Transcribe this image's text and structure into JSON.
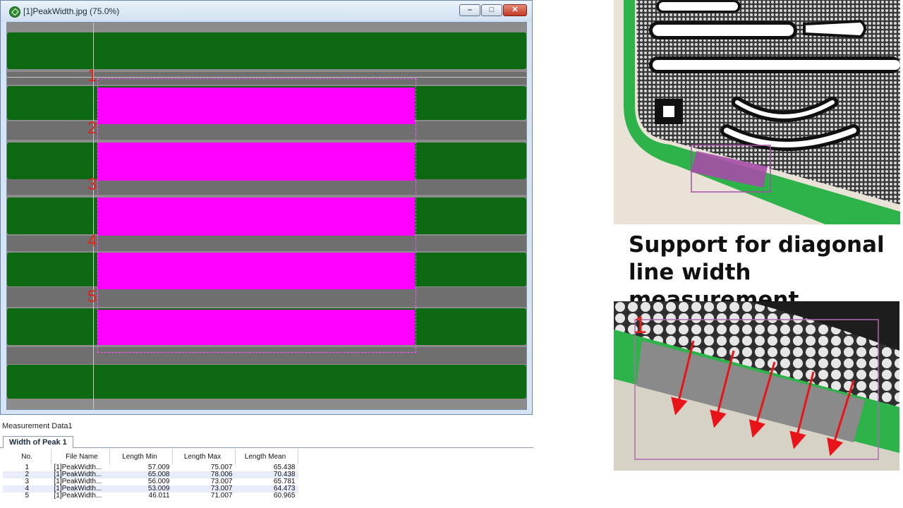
{
  "window": {
    "title": "[1]PeakWidth.jpg (75.0%)",
    "minimize_glyph": "–",
    "maximize_glyph": "□",
    "close_glyph": "✕"
  },
  "measurement": {
    "panel_title": "Measurement Data1",
    "tab_label": "Width of Peak 1",
    "columns": [
      "No.",
      "File Name",
      "Length Min",
      "Length Max",
      "Length Mean"
    ],
    "rows": [
      {
        "no": "1",
        "file": "[1]PeakWidth...",
        "min": "57.009",
        "max": "75.007",
        "mean": "65.438"
      },
      {
        "no": "2",
        "file": "[1]PeakWidth...",
        "min": "65.008",
        "max": "78.006",
        "mean": "70.438"
      },
      {
        "no": "3",
        "file": "[1]PeakWidth...",
        "min": "56.009",
        "max": "73.007",
        "mean": "65.781"
      },
      {
        "no": "4",
        "file": "[1]PeakWidth...",
        "min": "53.009",
        "max": "73.007",
        "mean": "64.473"
      },
      {
        "no": "5",
        "file": "[1]PeakWidth...",
        "min": "46.011",
        "max": "71.007",
        "mean": "60.965"
      }
    ]
  },
  "roi_labels": [
    "1",
    "2",
    "3",
    "4",
    "5"
  ],
  "diagonal_roi_label": "1",
  "caption": {
    "line1": "Support for diagonal",
    "line2": "line width measurement"
  },
  "colors": {
    "trace_green": "#0e6a12",
    "measured_magenta": "#ff00ff",
    "marker_red": "#e0241a",
    "pcb_green": "#2db34a"
  }
}
